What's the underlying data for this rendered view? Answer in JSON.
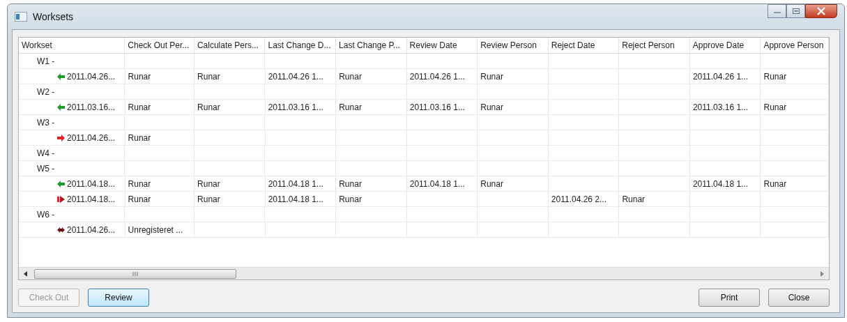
{
  "window": {
    "title": "Worksets"
  },
  "table": {
    "columns": [
      "Workset",
      "Check Out Per...",
      "Calculate Pers...",
      "Last Change D...",
      "Last Change P...",
      "Review Date",
      "Review Person",
      "Reject Date",
      "Reject Person",
      "Approve Date",
      "Approve Person"
    ],
    "rows": [
      {
        "label": "W1 -",
        "children": [
          {
            "kind": "green_left",
            "cells": [
              "2011.04.26...",
              "Runar",
              "Runar",
              "2011.04.26 1...",
              "Runar",
              "2011.04.26 1...",
              "Runar",
              null,
              null,
              "2011.04.26 1...",
              "Runar"
            ]
          }
        ]
      },
      {
        "label": "W2 -",
        "children": [
          {
            "kind": "green_left",
            "cells": [
              "2011.03.16...",
              "Runar",
              "Runar",
              "2011.03.16 1...",
              "Runar",
              "2011.03.16 1...",
              "Runar",
              null,
              null,
              "2011.03.16 1...",
              "Runar"
            ]
          }
        ]
      },
      {
        "label": "W3 -",
        "children": [
          {
            "kind": "red_right",
            "cells": [
              "2011.04.26...",
              "Runar",
              null,
              null,
              null,
              null,
              null,
              null,
              null,
              null,
              null
            ]
          }
        ]
      },
      {
        "label": "W4 -",
        "children": []
      },
      {
        "label": "W5 -",
        "children": [
          {
            "kind": "green_left",
            "cells": [
              "2011.04.18...",
              "Runar",
              "Runar",
              "2011.04.18 1...",
              "Runar",
              "2011.04.18 1...",
              "Runar",
              null,
              null,
              "2011.04.18 1...",
              "Runar"
            ]
          },
          {
            "kind": "split_red",
            "cells": [
              "2011.04.18...",
              "Runar",
              "Runar",
              "2011.04.18 1...",
              "Runar",
              null,
              null,
              "2011.04.26 2...",
              "Runar",
              null,
              null
            ]
          }
        ]
      },
      {
        "label": "W6 -",
        "children": [
          {
            "kind": "dark_cross",
            "cells": [
              "2011.04.26...",
              "Unregisteret ...",
              null,
              null,
              null,
              null,
              null,
              null,
              null,
              null,
              null
            ]
          }
        ]
      }
    ]
  },
  "buttons_left": [
    {
      "label": "Check Out",
      "disabled": true
    },
    {
      "label": "Review",
      "disabled": false
    }
  ],
  "buttons_right": [
    {
      "label": "Print",
      "disabled": false
    },
    {
      "label": "Close",
      "disabled": false
    }
  ]
}
